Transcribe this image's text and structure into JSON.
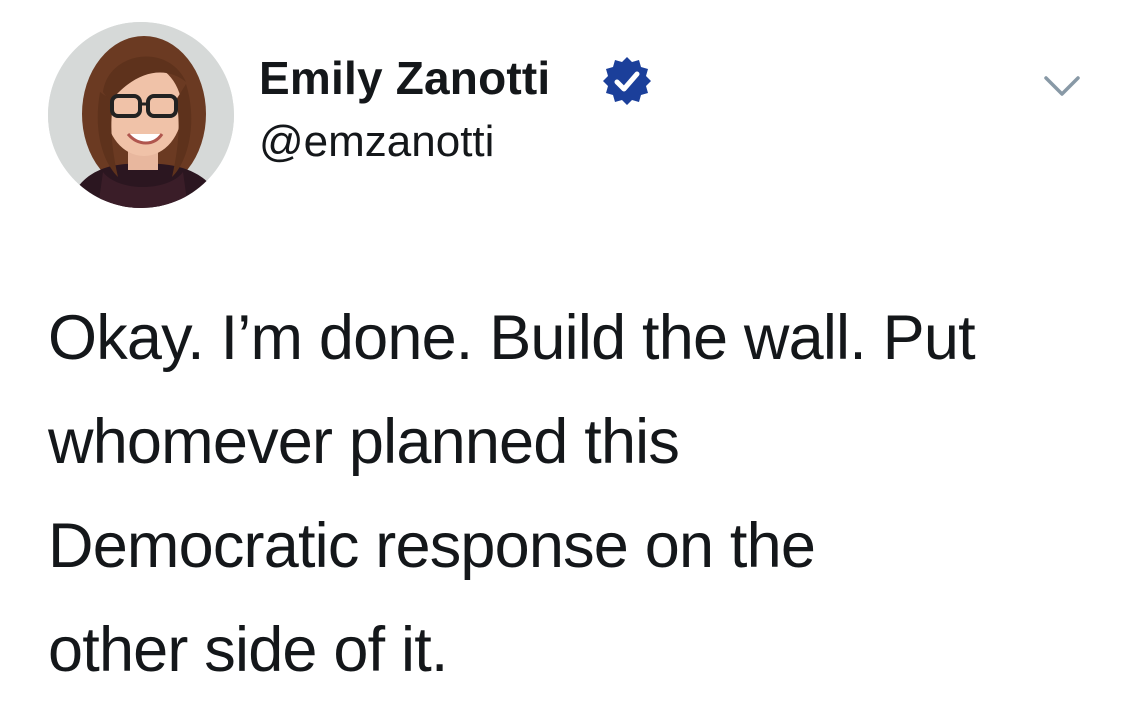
{
  "user": {
    "display_name": "Emily Zanotti",
    "handle": "@emzanotti",
    "verified": true,
    "avatar_icon": "profile-photo"
  },
  "tweet": {
    "lines": [
      "Okay. I’m done. Build the wall. Put",
      "whomever planned this",
      "Democratic response on the",
      "other side of it."
    ]
  },
  "icons": {
    "verified_badge": "verified-icon",
    "menu": "chevron-down-icon"
  },
  "colors": {
    "text": "#14171a",
    "verified": "#1b3f9a",
    "chevron": "#8899a6",
    "background": "#ffffff"
  }
}
